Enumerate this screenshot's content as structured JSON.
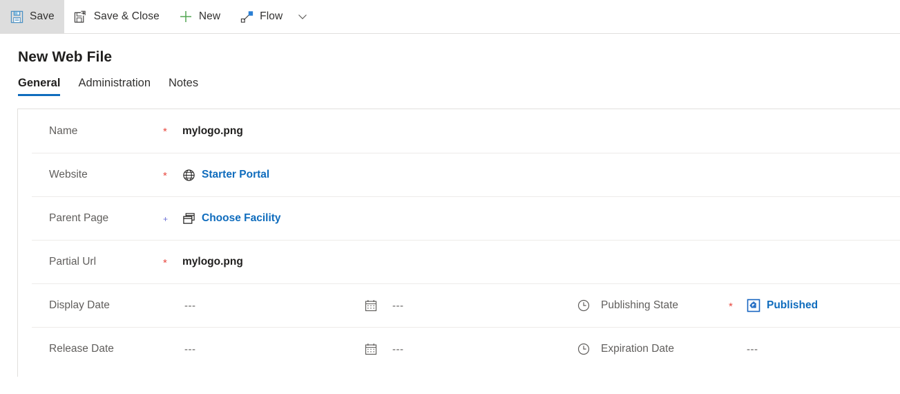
{
  "commandbar": {
    "buttons": [
      {
        "label": "Save",
        "icon": "save-icon",
        "active": true
      },
      {
        "label": "Save & Close",
        "icon": "save-close-icon",
        "active": false
      },
      {
        "label": "New",
        "icon": "plus-icon",
        "active": false
      },
      {
        "label": "Flow",
        "icon": "flow-icon",
        "active": false
      }
    ],
    "overflow_icon": "chevron-down-icon"
  },
  "page": {
    "title": "New Web File"
  },
  "tabs": [
    {
      "label": "General",
      "selected": true
    },
    {
      "label": "Administration",
      "selected": false
    },
    {
      "label": "Notes",
      "selected": false
    }
  ],
  "form": {
    "rows": [
      {
        "label": "Name",
        "required": "*",
        "value": "mylogo.png"
      },
      {
        "label": "Website",
        "required": "*",
        "link_text": "Starter Portal",
        "link_icon": "globe-icon"
      },
      {
        "label": "Parent Page",
        "required": "+",
        "link_text": "Choose Facility",
        "link_icon": "pages-icon"
      },
      {
        "label": "Partial Url",
        "required": "*",
        "value": "mylogo.png"
      },
      {
        "label": "Display Date",
        "required": "",
        "date_value": "---",
        "date_icon": "calendar-icon",
        "time_value": "---",
        "time_icon": "clock-icon",
        "right_label": "Publishing State",
        "right_required": "*",
        "right_link_text": "Published",
        "right_link_icon": "publishing-state-icon"
      },
      {
        "label": "Release Date",
        "required": "",
        "date_value": "---",
        "date_icon": "calendar-icon",
        "time_value": "---",
        "time_icon": "clock-icon",
        "right_label": "Expiration Date",
        "right_required": "",
        "right_value": "---"
      }
    ]
  },
  "colors": {
    "accent": "#0f6cbd",
    "required": "#e8483f",
    "optional": "#6b6fd6",
    "new_green": "#53a653",
    "label": "#605e5c",
    "border": "#e1dfdd",
    "row_border": "#edebe9",
    "active_btn_bg": "#dddddd"
  }
}
